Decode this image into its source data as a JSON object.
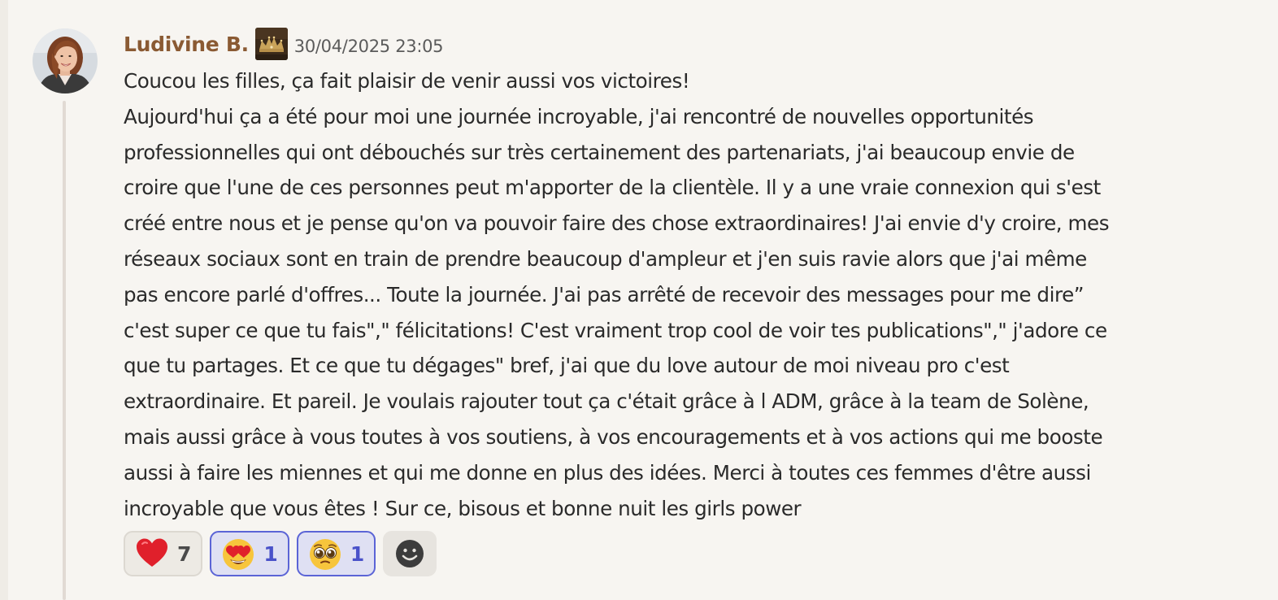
{
  "message": {
    "author": "Ludivine B.",
    "timestamp": "30/04/2025 23:05",
    "avatar_icon": "user-photo-avatar",
    "badge_icon": "crown-badge-icon",
    "lines": [
      "Coucou les filles, ça fait plaisir de venir aussi vos victoires!",
      "Aujourd'hui ça a été pour moi une journée incroyable, j'ai rencontré de nouvelles opportunités",
      "professionnelles qui ont débouchés sur très certainement des partenariats, j'ai beaucoup envie de",
      "croire que l'une de ces personnes peut m'apporter de la clientèle. Il y a une vraie connexion qui s'est",
      "créé entre nous et je pense qu'on va pouvoir faire des chose extraordinaires! J'ai envie d'y croire, mes",
      "réseaux sociaux sont en train de prendre beaucoup d'ampleur et j'en suis ravie alors que j'ai même",
      "pas encore parlé d'offres... Toute la journée. J'ai pas arrêté de recevoir des messages pour me dire”",
      "c'est super ce que tu fais\",\" félicitations! C'est vraiment trop cool de voir tes publications\",\" j'adore ce",
      "que tu partages. Et ce que tu dégages\" bref, j'ai que du love autour de moi niveau pro c'est",
      "extraordinaire. Et pareil. Je voulais rajouter tout ça c'était grâce à l ADM, grâce à la team de Solène,",
      "mais aussi grâce à vous toutes à vos soutiens, à vos encouragements et à vos actions qui me booste",
      "aussi à faire les miennes et qui me donne en plus des idées. Merci à toutes ces femmes d'être aussi",
      "incroyable que vous êtes ! Sur ce, bisous et bonne nuit les girls power"
    ]
  },
  "reactions": [
    {
      "icon": "red-heart-icon",
      "count": "7",
      "active": false
    },
    {
      "icon": "heart-eyes-emoji-icon",
      "count": "1",
      "active": true
    },
    {
      "icon": "pleading-face-emoji-icon",
      "count": "1",
      "active": true
    }
  ],
  "add_reaction_icon": "add-reaction-smiley-icon",
  "colors": {
    "background": "#f7f5f1",
    "author": "#8a5a33",
    "text": "#2a2a2a",
    "timestamp": "#5b5b5b",
    "active_reaction_border": "#5b64d6",
    "active_reaction_fill": "#dfe0f3",
    "heart": "#e0202b",
    "emoji_face": "#f7c53c"
  }
}
